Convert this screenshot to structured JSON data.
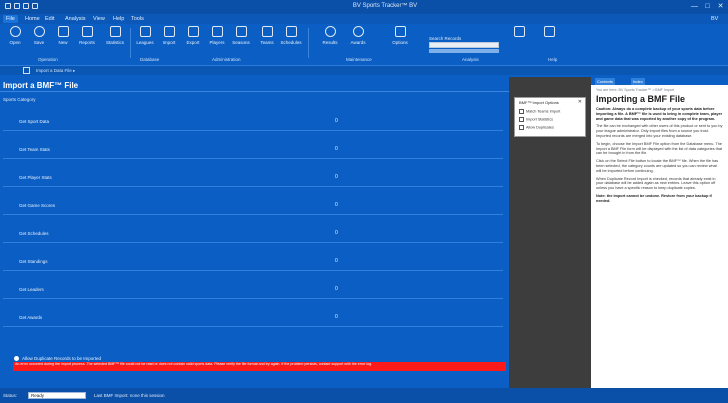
{
  "window": {
    "title": "BV Sports Tracker™ BV",
    "minimize": "—",
    "maximize": "□",
    "close": "✕",
    "right_label": "BV"
  },
  "menu": [
    "File",
    "Home",
    "Edit",
    "Analysis",
    "View",
    "Help",
    "Tools"
  ],
  "ribbon": {
    "buttons": [
      {
        "label": "Open",
        "icon": "folder-icon"
      },
      {
        "label": "Save",
        "icon": "save-icon"
      },
      {
        "label": "New",
        "icon": "new-file-icon"
      },
      {
        "label": "Reports",
        "icon": "report-icon"
      },
      {
        "label": "Statistics",
        "icon": "chart-icon"
      },
      {
        "label": "Leagues",
        "icon": "trophy-icon"
      },
      {
        "label": "Import",
        "icon": "import-icon"
      },
      {
        "label": "Export",
        "icon": "export-icon"
      },
      {
        "label": "Players",
        "icon": "players-icon"
      },
      {
        "label": "Seasons",
        "icon": "calendar-icon"
      },
      {
        "label": "Teams",
        "icon": "team-icon"
      },
      {
        "label": "Schedules",
        "icon": "schedule-icon"
      },
      {
        "label": "Results",
        "icon": "results-icon"
      },
      {
        "label": "Awards",
        "icon": "award-icon"
      },
      {
        "label": "Options",
        "icon": "options-icon"
      }
    ],
    "groups": [
      "Operation",
      "Database",
      "Administration",
      "Maintenance",
      "Analysis",
      "Help"
    ],
    "search_label": "Search Records"
  },
  "subbar": {
    "text": "Import a Data File ▸"
  },
  "main": {
    "title": "Import a BMF™ File",
    "section_label": "Sports Category",
    "rows": [
      {
        "label": "Get Sport Data",
        "value": "0"
      },
      {
        "label": "Get Team Stats",
        "value": "0"
      },
      {
        "label": "Get Player Stats",
        "value": "0"
      },
      {
        "label": "Get Game Scores",
        "value": "0"
      },
      {
        "label": "Get Schedules",
        "value": "0"
      },
      {
        "label": "Get Standings",
        "value": "0"
      },
      {
        "label": "Get Leaders",
        "value": "0"
      },
      {
        "label": "Get Awards",
        "value": "0"
      }
    ],
    "radio_label": "Allow Duplicate Records to be Imported",
    "error": "An error occurred during the import process. The selected BMF™ file could not be read or does not contain valid sports data. Please verify the file format and try again. If the problem persists, contact support with the error log."
  },
  "popup": {
    "title": "BMF™ Import Options",
    "close": "✕",
    "items": [
      "Match Teams Import",
      "Import Statistics",
      "Allow Duplicates"
    ]
  },
  "help": {
    "tabs": [
      "Contents",
      "Index"
    ],
    "breadcrumb": "You are here: BV Sports Tracker™ > BMF Import",
    "title": "Importing a BMF File",
    "paragraphs": [
      "Caution: Always do a complete backup of your sports data before importing a file. A BMF™ file is used to bring in complete team, player and game data that was exported by another copy of the program.",
      "The file can be exchanged with other users of this product or sent to you by your league administrator. Only import files from a source you trust. Imported records are merged into your existing database.",
      "To begin, choose the Import BMF File option from the Database menu. The Import a BMF File form will be displayed with the list of data categories that can be brought in from the file.",
      "Click on the Select File button to locate the BMF™ file. When the file has been selected, the category counts are updated so you can review what will be imported before continuing.",
      "When Duplicate Record Import is checked, records that already exist in your database will be added again as new entries. Leave this option off unless you have a specific reason to keep duplicate copies.",
      "Note: the import cannot be undone. Restore from your backup if needed."
    ]
  },
  "status": {
    "label": "Status:",
    "field_value": "Ready",
    "text": "Last BMF Import: none this session"
  }
}
